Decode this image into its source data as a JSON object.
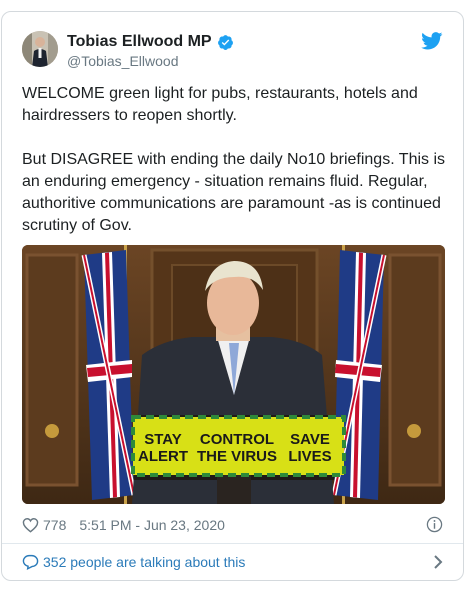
{
  "author": {
    "display_name": "Tobias Ellwood MP",
    "handle": "@Tobias_Ellwood",
    "verified": true
  },
  "tweet": {
    "text": "WELCOME green light for pubs, restaurants, hotels and hairdressers to reopen shortly.\n\nBut DISAGREE with ending the daily No10 briefings. This is an enduring emergency - situation remains fluid. Regular, authoritive communications are paramount -as is continued scrutiny of Gov.",
    "likes": "778",
    "timestamp": "5:51 PM - Jun 23, 2020"
  },
  "media": {
    "lectern_sign": {
      "left": [
        "STAY",
        "ALERT"
      ],
      "middle": [
        "CONTROL",
        "THE VIRUS"
      ],
      "right": [
        "SAVE",
        "LIVES"
      ]
    }
  },
  "footer": {
    "talking_text": "352 people are talking about this"
  },
  "icons": {
    "verified": "verified-badge-icon",
    "platform": "twitter-bird-icon",
    "like": "heart-icon",
    "info": "info-icon",
    "conversation": "speech-bubble-icon",
    "chevron": "chevron-right-icon"
  },
  "colors": {
    "brand_blue": "#1da1f2",
    "link_blue": "#2b7bb9",
    "secondary_text": "#697882",
    "sign_yellow": "#d8e016",
    "sign_green": "#2e8a3a"
  }
}
